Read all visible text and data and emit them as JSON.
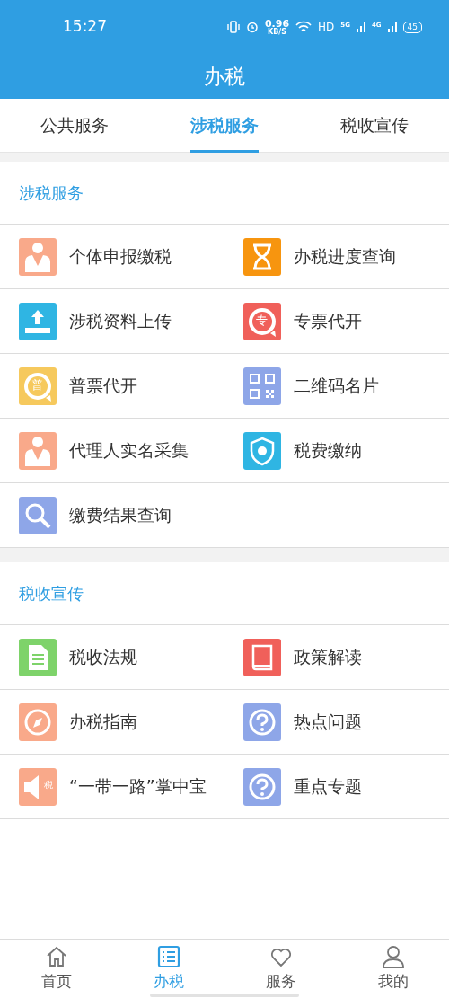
{
  "status_bar": {
    "time": "15:27",
    "speed": "0.96",
    "speed_unit": "KB/S",
    "hd": "HD",
    "net1": "5G",
    "net2": "4G",
    "battery": "45"
  },
  "header": {
    "title": "办税"
  },
  "tabs": [
    {
      "label": "公共服务",
      "selected": false
    },
    {
      "label": "涉税服务",
      "selected": true
    },
    {
      "label": "税收宣传",
      "selected": false
    }
  ],
  "sections": [
    {
      "title": "涉税服务",
      "items": [
        {
          "label": "个体申报缴税",
          "kind": "person"
        },
        {
          "label": "办税进度查询",
          "kind": "hourglass"
        },
        {
          "label": "涉税资料上传",
          "kind": "upload"
        },
        {
          "label": "专票代开",
          "kind": "bubble-red",
          "icon_text": "专"
        },
        {
          "label": "普票代开",
          "kind": "bubble-yellow",
          "icon_text": "普"
        },
        {
          "label": "二维码名片",
          "kind": "qr"
        },
        {
          "label": "代理人实名采集",
          "kind": "person"
        },
        {
          "label": "税费缴纳",
          "kind": "shield"
        },
        {
          "label": "缴费结果查询",
          "kind": "search"
        }
      ]
    },
    {
      "title": "税收宣传",
      "items": [
        {
          "label": "税收法规",
          "kind": "doc"
        },
        {
          "label": "政策解读",
          "kind": "book"
        },
        {
          "label": "办税指南",
          "kind": "compass"
        },
        {
          "label": "热点问题",
          "kind": "question"
        },
        {
          "label": "“一带一路”掌中宝",
          "kind": "speaker",
          "icon_text": "税"
        },
        {
          "label": "重点专题",
          "kind": "question"
        }
      ]
    }
  ],
  "bottom_nav": [
    {
      "label": "首页",
      "kind": "home",
      "selected": false
    },
    {
      "label": "办税",
      "kind": "list",
      "selected": true
    },
    {
      "label": "服务",
      "kind": "heart",
      "selected": false
    },
    {
      "label": "我的",
      "kind": "user",
      "selected": false
    }
  ]
}
